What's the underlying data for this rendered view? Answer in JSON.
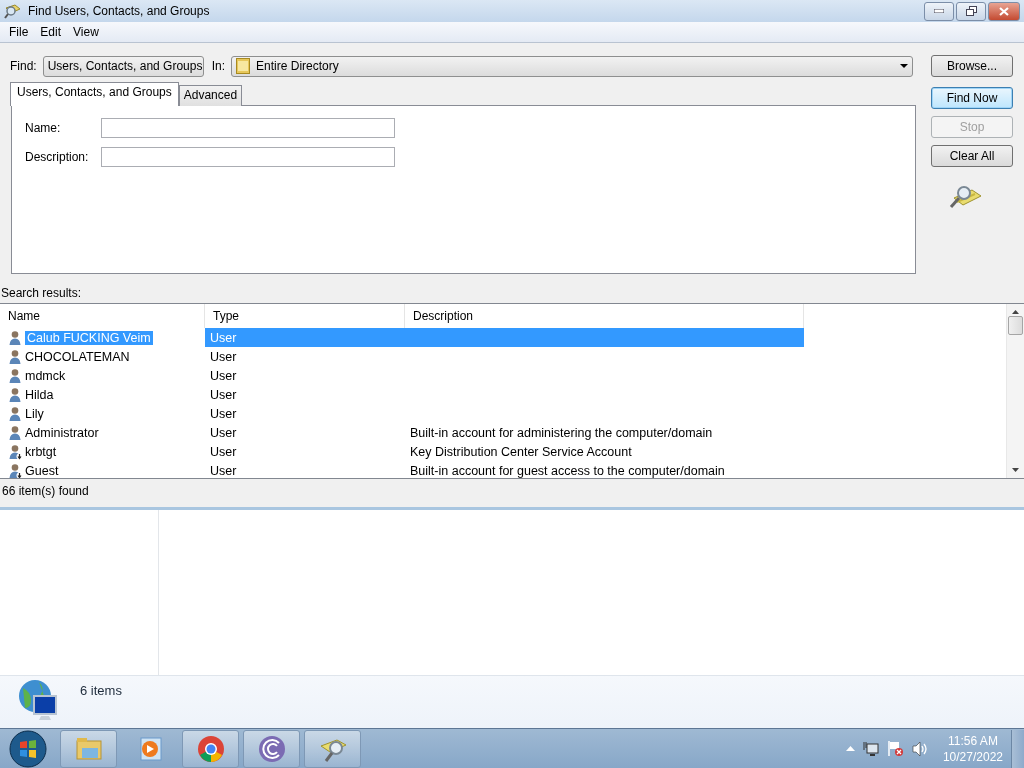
{
  "window": {
    "title": "Find Users, Contacts, and Groups"
  },
  "menu": [
    {
      "label": "File"
    },
    {
      "label": "Edit"
    },
    {
      "label": "View"
    }
  ],
  "find": {
    "label": "Find:",
    "value": "Users, Contacts, and Groups"
  },
  "in": {
    "label": "In:",
    "value": "Entire Directory"
  },
  "browse_button": "Browse...",
  "tabs": [
    {
      "label": "Users, Contacts, and Groups",
      "selected": true
    },
    {
      "label": "Advanced",
      "selected": false
    }
  ],
  "fields": [
    {
      "label": "Name:"
    },
    {
      "label": "Description:"
    }
  ],
  "buttons": [
    {
      "label": "Find Now",
      "disabled": false,
      "default": true
    },
    {
      "label": "Stop",
      "disabled": true,
      "default": false
    },
    {
      "label": "Clear All",
      "disabled": false,
      "default": false
    }
  ],
  "results_label": "Search results:",
  "table": {
    "columns": [
      "Name",
      "Type",
      "Description"
    ],
    "rows": [
      {
        "kind": "user",
        "name": "Calub FUCKING Veim",
        "type": "User",
        "selected": true
      },
      {
        "kind": "user",
        "name": "CHOCOLATEMAN",
        "type": "User",
        "selected": false
      },
      {
        "kind": "user",
        "name": "mdmck",
        "type": "User",
        "selected": false
      },
      {
        "kind": "user",
        "name": "Hilda",
        "type": "User",
        "selected": false
      },
      {
        "kind": "user",
        "name": "Lily",
        "type": "User",
        "selected": false
      },
      {
        "kind": "user",
        "name": "Administrator",
        "type": "User",
        "description": "Built-in account for administering the computer/domain",
        "selected": false
      },
      {
        "kind": "disabled_user",
        "name": "krbtgt",
        "type": "User",
        "description": "Key Distribution Center Service Account",
        "selected": false
      },
      {
        "kind": "disabled_user",
        "name": "Guest",
        "type": "User",
        "description": "Built-in account for guest access to the computer/domain",
        "selected": false
      }
    ]
  },
  "status_bar": "66 item(s) found",
  "explorer": {
    "status": "6 items"
  },
  "taskbar": {
    "time": "11:56 AM",
    "date": "10/27/2022"
  }
}
